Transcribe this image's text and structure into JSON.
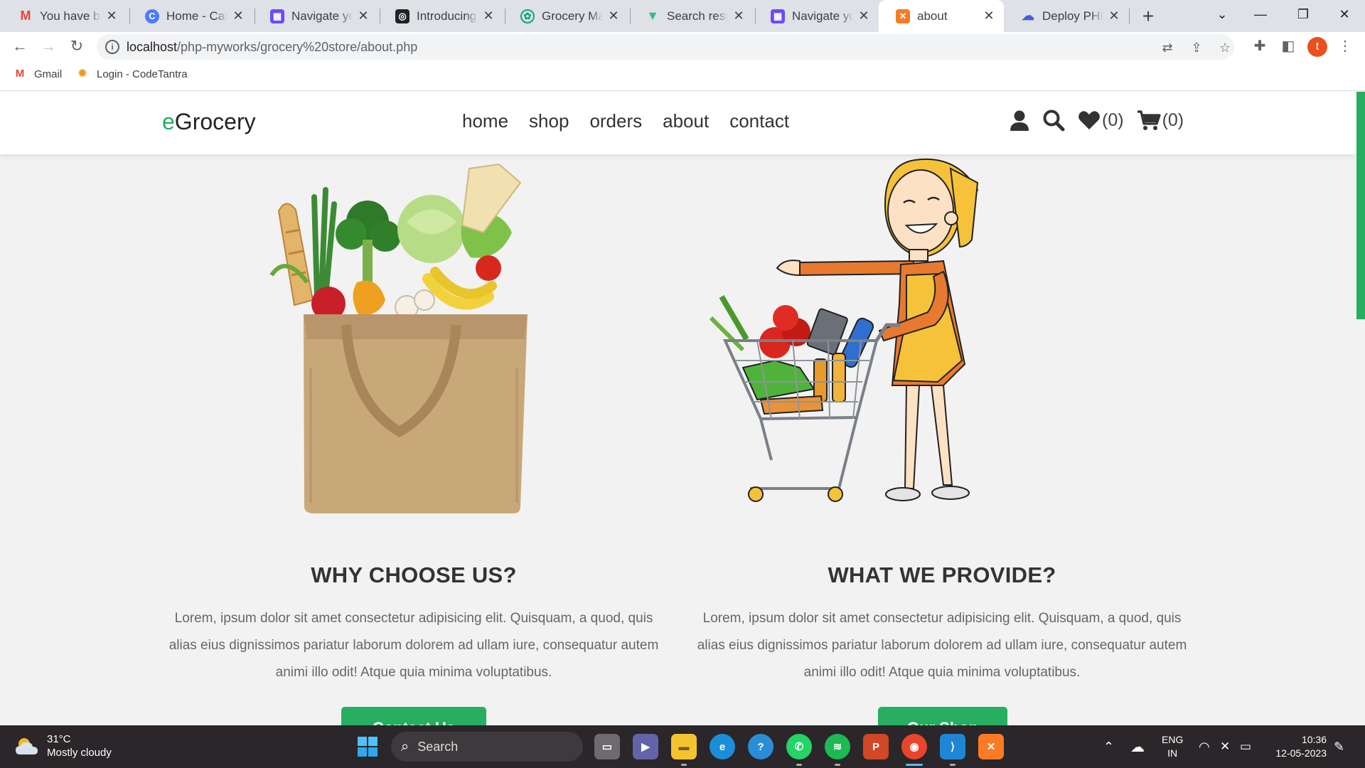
{
  "browser": {
    "tabs": [
      {
        "title": "You have been",
        "icon": "gmail-icon",
        "color": "#ea4335"
      },
      {
        "title": "Home - Canva",
        "icon": "canva-icon",
        "color": "#00c4cc"
      },
      {
        "title": "Navigate your",
        "icon": "notion-calendar-icon",
        "color": "#6b4bff"
      },
      {
        "title": "Introducing Cl",
        "icon": "openai-icon",
        "color": "#222222"
      },
      {
        "title": "Grocery Mana",
        "icon": "chatgpt-icon",
        "color": "#10a37f"
      },
      {
        "title": "Search results",
        "icon": "vue-icon",
        "color": "#41b883"
      },
      {
        "title": "Navigate your",
        "icon": "notion-calendar-icon",
        "color": "#6b4bff"
      },
      {
        "title": "about",
        "icon": "xampp-icon",
        "color": "#fb7a24",
        "active": true
      },
      {
        "title": "Deploy PHP A",
        "icon": "cloud-icon",
        "color": "#4a5cd6"
      }
    ],
    "url_host": "localhost",
    "url_path": "/php-myworks/grocery%20store/about.php",
    "bookmarks": [
      {
        "label": "Gmail",
        "icon": "gmail-icon"
      },
      {
        "label": "Login - CodeTantra",
        "icon": "codetantra-icon"
      }
    ],
    "profile_initial": "t"
  },
  "site": {
    "logo_accent": "e",
    "logo_rest": "Grocery",
    "nav": [
      "home",
      "shop",
      "orders",
      "about",
      "contact"
    ],
    "wishlist_count": "(0)",
    "cart_count": "(0)",
    "accent_color": "#27ae60"
  },
  "sections": [
    {
      "title": "WHY CHOOSE US?",
      "text": "Lorem, ipsum dolor sit amet consectetur adipisicing elit. Quisquam, a quod, quis alias eius dignissimos pariatur laborum dolorem ad ullam iure, consequatur autem animi illo odit! Atque quia minima voluptatibus.",
      "button": "Contact Us",
      "image": "grocery-bag-image"
    },
    {
      "title": "WHAT WE PROVIDE?",
      "text": "Lorem, ipsum dolor sit amet consectetur adipisicing elit. Quisquam, a quod, quis alias eius dignissimos pariatur laborum dolorem ad ullam iure, consequatur autem animi illo odit! Atque quia minima voluptatibus.",
      "button": "Our Shop",
      "image": "shopper-cart-image"
    }
  ],
  "taskbar": {
    "temp": "31°C",
    "weather": "Mostly cloudy",
    "search": "Search",
    "lang1": "ENG",
    "lang2": "IN",
    "time": "10:36",
    "date": "12-05-2023"
  }
}
